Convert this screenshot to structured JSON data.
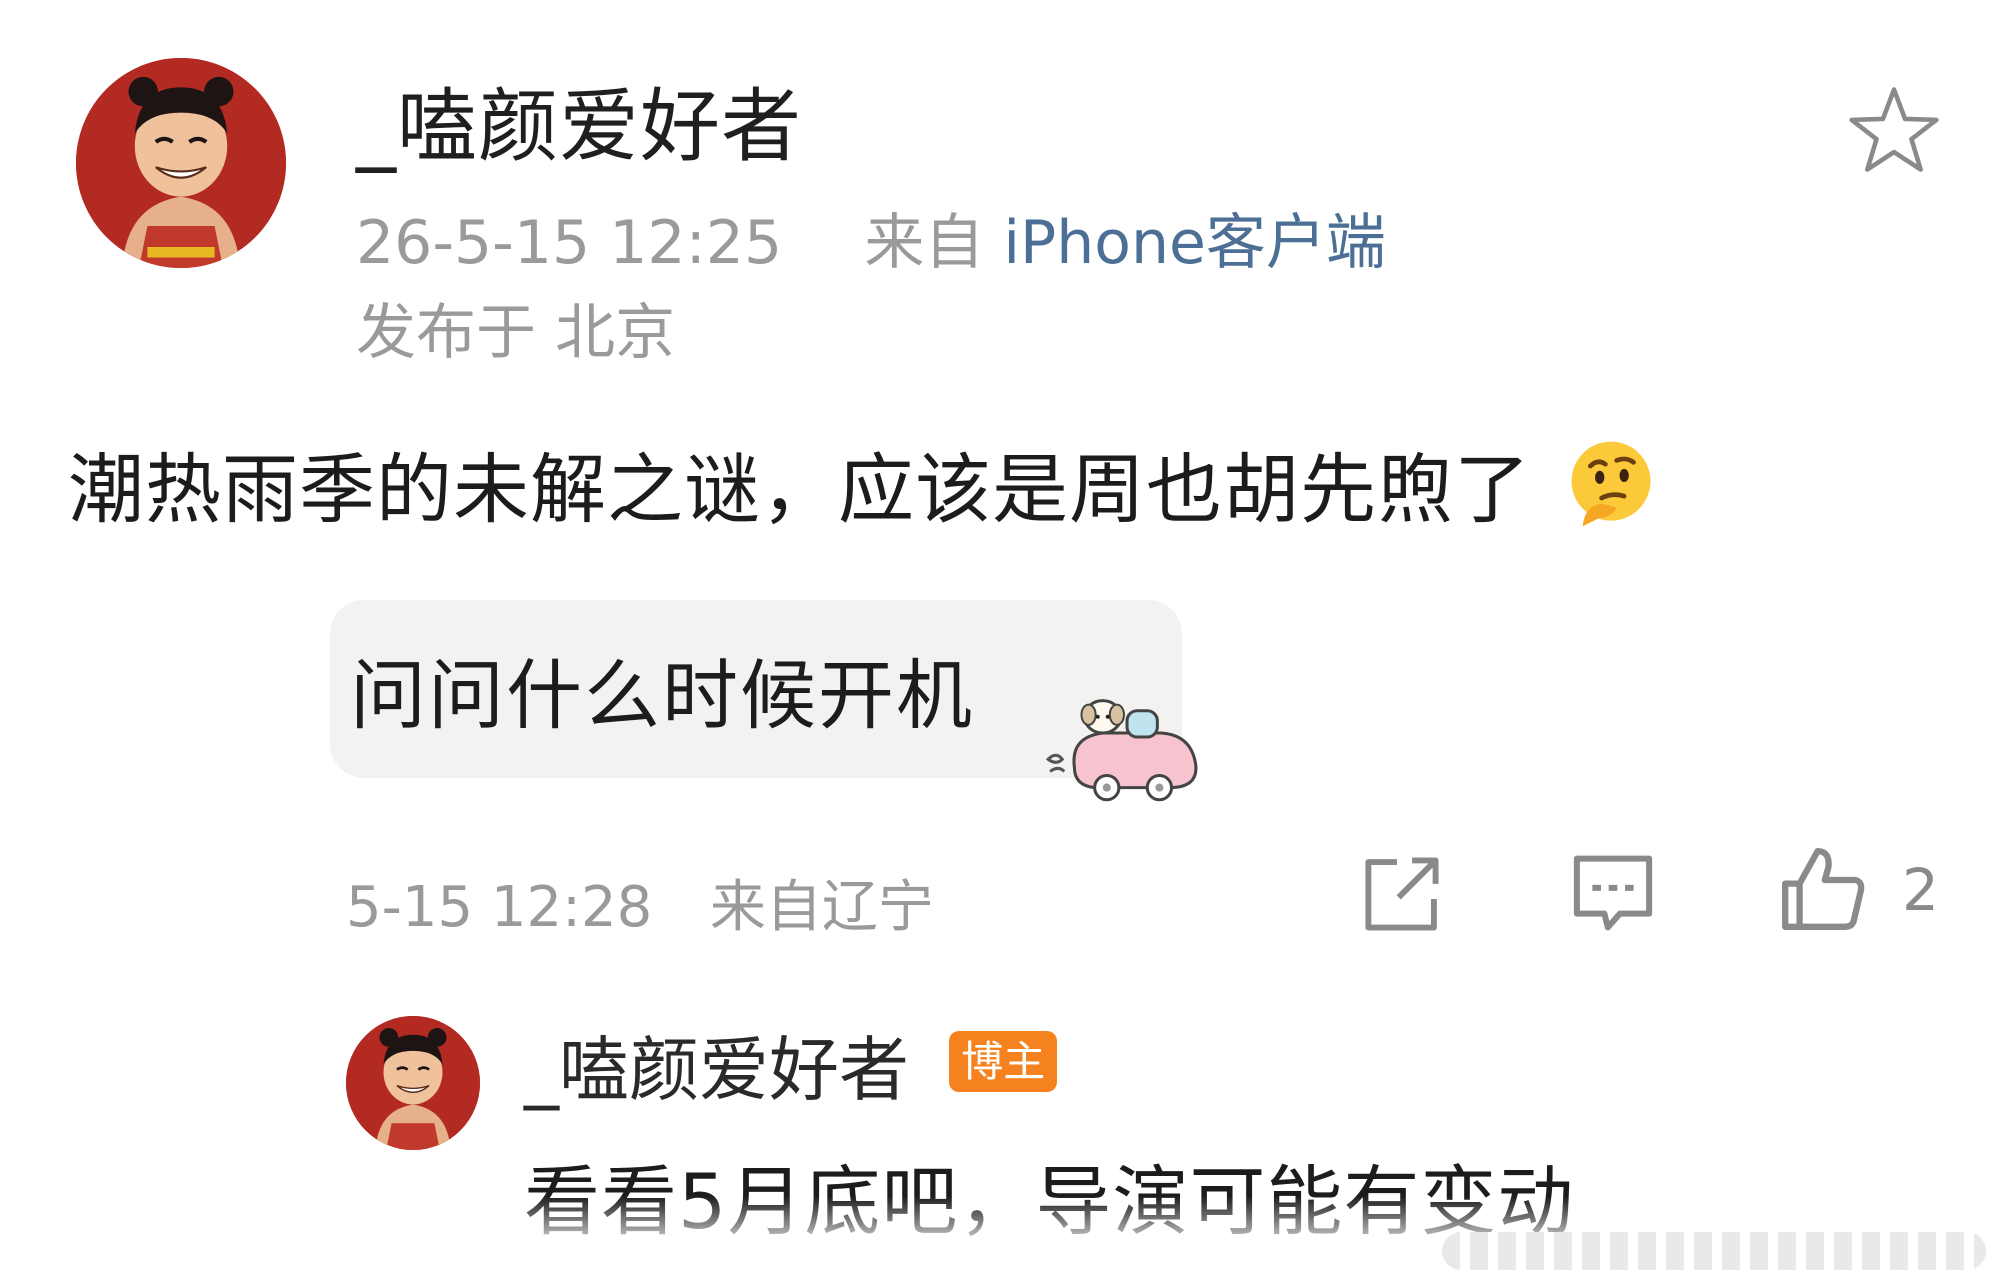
{
  "post": {
    "author": "_嗑颜爱好者",
    "timestamp": "26-5-15 12:25",
    "source_prefix": "来自",
    "client": "iPhone客户端",
    "location": "发布于 北京",
    "text": "潮热雨季的未解之谜，应该是周也胡先煦了",
    "emoji_icon": "thinking-face-icon",
    "favorite_icon": "star-outline-icon"
  },
  "quote": {
    "text": "问问什么时候开机",
    "sticker_icon": "puppy-car-sticker-icon"
  },
  "actions": {
    "timestamp": "5-15 12:28",
    "source": "来自辽宁",
    "share_icon": "share-icon",
    "comment_icon": "comment-icon",
    "like_icon": "thumbs-up-icon",
    "like_count": "2"
  },
  "reply": {
    "author": "_嗑颜爱好者",
    "badge": "博主",
    "text": "看看5月底吧，导演可能有变动"
  },
  "colors": {
    "avatar_bg": "#b22a22",
    "client_link": "#4b6f95",
    "badge_bg": "#f5821f",
    "meta_gray": "#9a9a9a"
  }
}
